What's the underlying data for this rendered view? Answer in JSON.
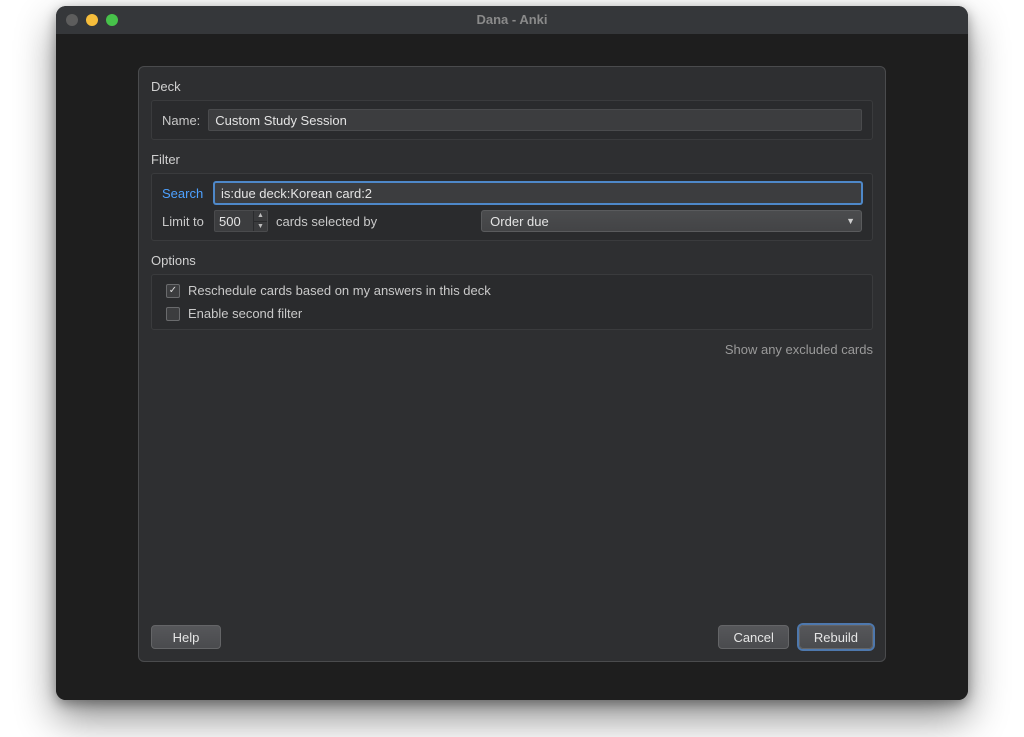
{
  "window": {
    "title": "Dana - Anki"
  },
  "deck": {
    "section_label": "Deck",
    "name_label": "Name:",
    "name_value": "Custom Study Session"
  },
  "filter": {
    "section_label": "Filter",
    "search_label": "Search",
    "search_value": "is:due deck:Korean card:2",
    "limit_label": "Limit to",
    "limit_value": "500",
    "selected_by_label": "cards selected by",
    "order_value": "Order due"
  },
  "options": {
    "section_label": "Options",
    "reschedule_label": "Reschedule cards based on my answers in this deck",
    "reschedule_checked": true,
    "second_filter_label": "Enable second filter",
    "second_filter_checked": false,
    "show_excluded_label": "Show any excluded cards"
  },
  "buttons": {
    "help": "Help",
    "cancel": "Cancel",
    "rebuild": "Rebuild"
  }
}
